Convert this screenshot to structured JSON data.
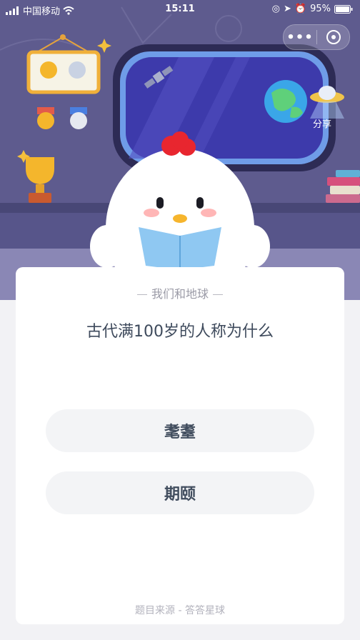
{
  "status": {
    "carrier": "中国移动",
    "time": "15:11",
    "battery": "95%"
  },
  "menu": {
    "more_icon": "more-dots-icon",
    "close_icon": "close-circle-icon"
  },
  "share": {
    "label": "分享"
  },
  "quiz": {
    "category": "我们和地球",
    "question": "古代满100岁的人称为什么",
    "options": [
      "耄耋",
      "期颐"
    ],
    "source": "题目来源 - 答答星球"
  },
  "colors": {
    "scene_bg": "#5e5b8e",
    "card_bg": "#ffffff",
    "option_bg": "#f3f4f6",
    "accent_red": "#e8262f"
  }
}
